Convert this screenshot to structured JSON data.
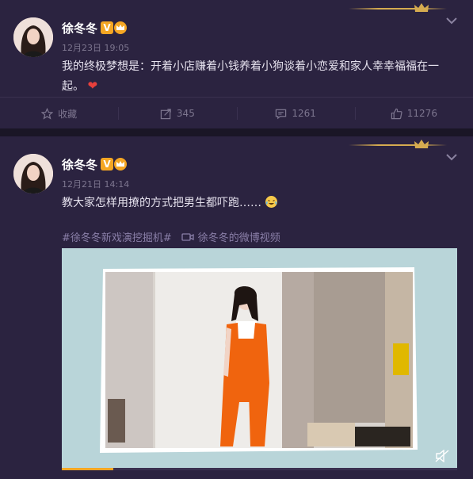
{
  "posts": [
    {
      "username": "徐冬冬",
      "verified_badge": "V",
      "timestamp": "12月23日 19:05",
      "text": "我的终极梦想是：开着小店赚着小钱养着小狗谈着小恋爱和家人幸幸福福在一起。",
      "emoji": "heart",
      "actions": {
        "favorite_label": "收藏",
        "repost_count": "345",
        "comment_count": "1261",
        "like_count": "11276"
      }
    },
    {
      "username": "徐冬冬",
      "verified_badge": "V",
      "timestamp": "12月21日 14:14",
      "text": "教大家怎样用撩的方式把男生都吓跑……",
      "emoji": "laughing-crying",
      "topic": "#徐冬冬新戏演挖掘机#",
      "video_link": "徐冬冬的微博视频",
      "video": {
        "progress": 0.13
      }
    }
  ],
  "colors": {
    "background": "#1a1626",
    "card": "#2b2340",
    "accent_gold": "#d5ab50",
    "badge_orange": "#f5a623",
    "meta_text": "#7d768f",
    "link": "#8a7fa8"
  }
}
